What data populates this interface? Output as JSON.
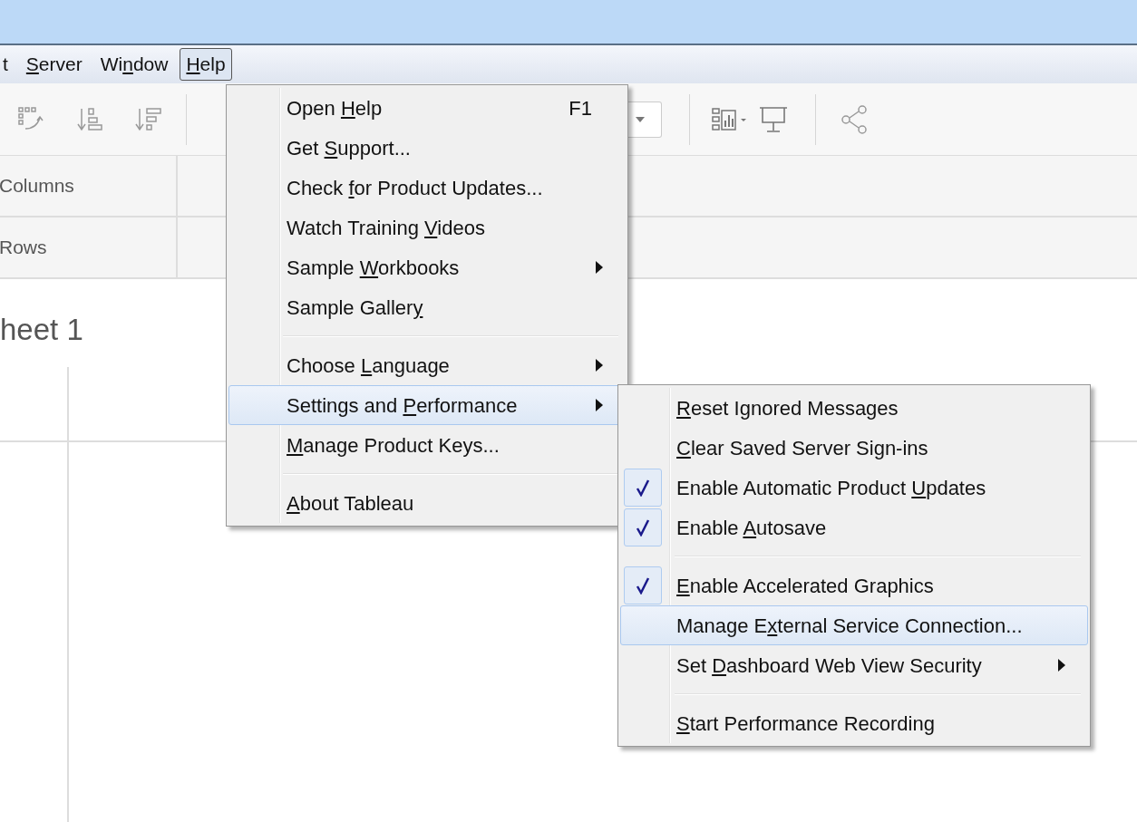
{
  "menu_bar": [
    {
      "label_parts": {
        "before": "t"
      }
    },
    {
      "label_parts": {
        "key": "S",
        "after": "erver"
      }
    },
    {
      "label_parts": {
        "before": "Wi",
        "key": "n",
        "after": "dow"
      }
    },
    {
      "label_parts": {
        "key": "H",
        "after": "elp"
      },
      "selected": true
    }
  ],
  "shelves": [
    {
      "label": "Columns"
    },
    {
      "label": "Rows"
    }
  ],
  "sheet_title": "heet 1",
  "help_menu": [
    {
      "kind": "item",
      "label_parts": {
        "before": "Open ",
        "key": "H",
        "after": "elp"
      },
      "shortcut": "F1",
      "submenu": false,
      "selected": false
    },
    {
      "kind": "item",
      "label_parts": {
        "before": "Get ",
        "key": "S",
        "after": "upport..."
      },
      "submenu": false,
      "selected": false
    },
    {
      "kind": "item",
      "label_parts": {
        "before": "Check ",
        "key": "f",
        "after": "or Product Updates..."
      },
      "submenu": false,
      "selected": false
    },
    {
      "kind": "item",
      "label_parts": {
        "before": "Watch Training ",
        "key": "V",
        "after": "ideos"
      },
      "submenu": false,
      "selected": false
    },
    {
      "kind": "item",
      "label_parts": {
        "before": "Sample ",
        "key": "W",
        "after": "orkbooks"
      },
      "submenu": true,
      "selected": false
    },
    {
      "kind": "item",
      "label_parts": {
        "before": "Sample Galler",
        "key": "y"
      },
      "submenu": false,
      "selected": false
    },
    {
      "kind": "separator"
    },
    {
      "kind": "item",
      "label_parts": {
        "before": "Choose ",
        "key": "L",
        "after": "anguage"
      },
      "submenu": true,
      "selected": false
    },
    {
      "kind": "item",
      "label_parts": {
        "before": "Settings and ",
        "key": "P",
        "after": "erformance"
      },
      "submenu": true,
      "selected": true
    },
    {
      "kind": "item",
      "label_parts": {
        "key": "M",
        "after": "anage Product Keys..."
      },
      "submenu": false,
      "selected": false
    },
    {
      "kind": "separator"
    },
    {
      "kind": "item",
      "label_parts": {
        "key": "A",
        "after": "bout Tableau"
      },
      "submenu": false,
      "selected": false
    }
  ],
  "settings_submenu": [
    {
      "kind": "item",
      "label_parts": {
        "key": "R",
        "after": "eset Ignored Messages"
      },
      "checked": false,
      "submenu": false,
      "selected": false
    },
    {
      "kind": "item",
      "label_parts": {
        "key": "C",
        "after": "lear Saved Server Sign-ins"
      },
      "checked": false,
      "submenu": false,
      "selected": false
    },
    {
      "kind": "item",
      "label_parts": {
        "before": "Enable Automatic Product ",
        "key": "U",
        "after": "pdates"
      },
      "checked": true,
      "submenu": false,
      "selected": false
    },
    {
      "kind": "item",
      "label_parts": {
        "before": "Enable ",
        "key": "A",
        "after": "utosave"
      },
      "checked": true,
      "submenu": false,
      "selected": false
    },
    {
      "kind": "separator"
    },
    {
      "kind": "item",
      "label_parts": {
        "key": "E",
        "after": "nable Accelerated Graphics"
      },
      "checked": true,
      "submenu": false,
      "selected": false
    },
    {
      "kind": "item",
      "label_parts": {
        "before": "Manage E",
        "key": "x",
        "after": "ternal Service Connection..."
      },
      "checked": false,
      "submenu": false,
      "selected": true
    },
    {
      "kind": "item",
      "label_parts": {
        "before": "Set ",
        "key": "D",
        "after": "ashboard Web View Security"
      },
      "checked": false,
      "submenu": true,
      "selected": false
    },
    {
      "kind": "separator"
    },
    {
      "kind": "item",
      "label_parts": {
        "key": "S",
        "after": "tart Performance Recording"
      },
      "checked": false,
      "submenu": false,
      "selected": false
    }
  ]
}
